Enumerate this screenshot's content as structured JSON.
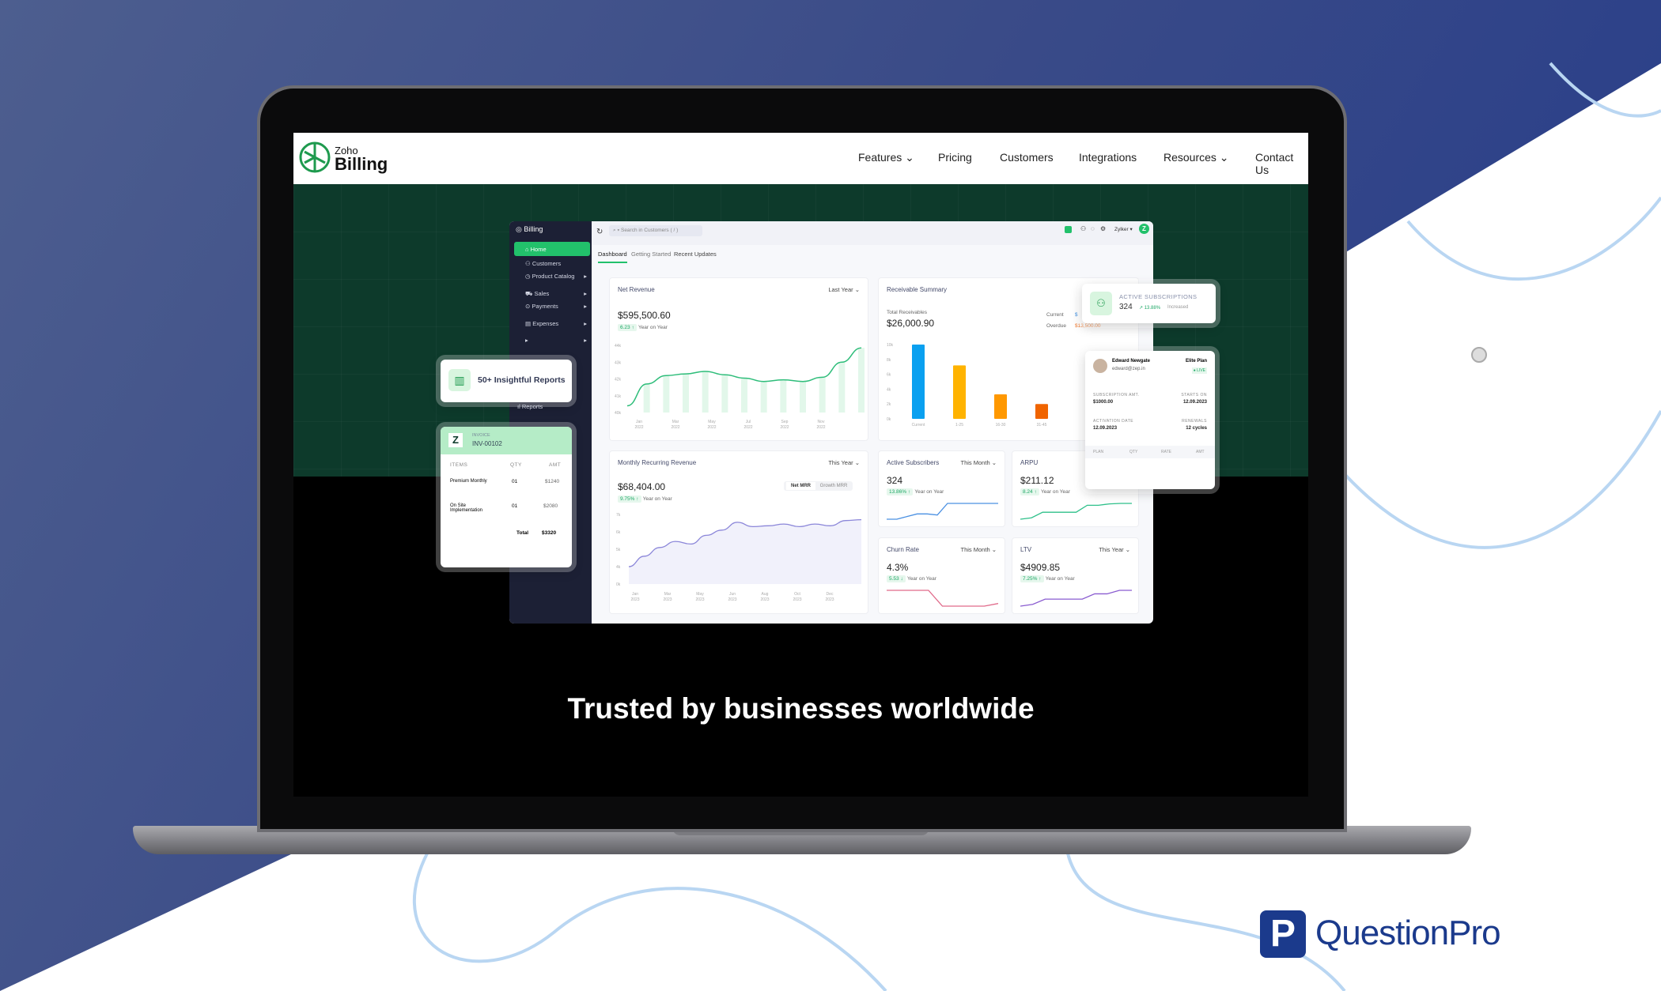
{
  "site": {
    "brand_small": "Zoho",
    "brand_large": "Billing",
    "nav": [
      "Features",
      "Pricing",
      "Customers",
      "Integrations",
      "Resources",
      "Contact Us"
    ],
    "headline": "Trusted by businesses worldwide"
  },
  "colors": {
    "accent": "#22c16b",
    "sidebar": "#1c2035",
    "hero": "#0d3a2b"
  },
  "dashboard": {
    "app_name": "Billing",
    "search_placeholder": "Search in Customers ( / )",
    "org": "Zylker",
    "avatar_letter": "Z",
    "sidebar": [
      "Home",
      "Customers",
      "Product Catalog",
      "Sales",
      "Payments",
      "Expenses",
      "",
      "Reports"
    ],
    "tabs": [
      "Dashboard",
      "Getting Started",
      "Recent Updates"
    ],
    "net_revenue": {
      "title": "Net Revenue",
      "period": "Last Year",
      "value": "$595,500.60",
      "change": "6.23 ↑",
      "change_label": "Year on Year",
      "yticks": [
        "44k",
        "43k",
        "42k",
        "41k",
        "40k"
      ],
      "xticks": [
        "Jan\n2022",
        "Mar\n2022",
        "May\n2022",
        "Jul\n2022",
        "Sep\n2022",
        "Nov\n2022"
      ],
      "yrange": [
        40,
        44
      ],
      "values": [
        40.4,
        41.7,
        42.2,
        42.3,
        42.45,
        42.25,
        42.05,
        41.85,
        41.95,
        41.85,
        42.1,
        43.0,
        43.85
      ]
    },
    "receivables": {
      "title": "Receivable Summary",
      "total_label": "Total Receivables",
      "total": "$26,000.90",
      "current_label": "Current",
      "current_value": "$",
      "overdue_label": "Overdue",
      "overdue_value": "$13,500.00",
      "yticks": [
        "10k",
        "8k",
        "6k",
        "4k",
        "2k",
        "0k"
      ],
      "yrange": [
        0,
        10
      ],
      "categories": [
        "Current",
        "1-25",
        "16-30",
        "31-45"
      ],
      "values": [
        10,
        7.2,
        3.3,
        2
      ],
      "bar_colors": [
        "#0aa0f0",
        "#ffb300",
        "#ff9800",
        "#f06400"
      ]
    },
    "mrr": {
      "title": "Monthly Recurring Revenue",
      "period": "This Year",
      "value": "$68,404.00",
      "change": "9.75% ↑",
      "change_label": "Year on Year",
      "toggle": [
        "Net MRR",
        "Growth MRR"
      ],
      "yticks": [
        "7k",
        "6k",
        "5k",
        "4k",
        "0k"
      ],
      "xticks": [
        "Jan\n2023",
        "Mar\n2023",
        "May\n2023",
        "Jun\n2023",
        "Aug\n2023",
        "Oct\n2023",
        "Dec\n2023"
      ],
      "values": [
        4.0,
        4.6,
        5.1,
        5.45,
        5.3,
        5.8,
        6.1,
        6.55,
        6.3,
        6.35,
        6.45,
        6.3,
        6.45,
        6.35,
        6.65,
        6.7
      ]
    },
    "active_subscribers": {
      "title": "Active Subscribers",
      "period": "This Month",
      "value": "324",
      "change": "13.86% ↑",
      "change_label": "Year on Year",
      "color": "#4a90e2",
      "values": [
        0,
        0,
        1,
        2,
        2,
        1.6,
        6,
        6,
        6,
        6,
        6,
        6
      ]
    },
    "arpu": {
      "title": "ARPU",
      "value": "$211.12",
      "change": "8.24 ↑",
      "change_label": "Year on Year",
      "color": "#2ec08a",
      "values": [
        0,
        0.3,
        1.5,
        1.5,
        1.5,
        1.5,
        3,
        3,
        3.3,
        3.4,
        3.4
      ]
    },
    "churn": {
      "title": "Churn Rate",
      "period": "This Month",
      "value": "4.3%",
      "change": "5.53 ↓",
      "change_label": "Year on Year",
      "color": "#e06a8a",
      "values": [
        6,
        6,
        6,
        6,
        0,
        0,
        0,
        0,
        1
      ]
    },
    "ltv": {
      "title": "LTV",
      "period": "This Year",
      "value": "$4909.85",
      "change": "7.25% ↑",
      "change_label": "Year on Year",
      "color": "#8a5cd0",
      "values": [
        0,
        0.5,
        2,
        2,
        2,
        2,
        3.5,
        3.5,
        4.5,
        4.5
      ]
    }
  },
  "reports_card": {
    "label": "50+ Insightful Reports"
  },
  "invoice": {
    "label": "INVOICE",
    "number": "INV-00102",
    "headers": [
      "ITEMS",
      "QTY",
      "AMT"
    ],
    "rows": [
      [
        "Premium Monthly",
        "01",
        "$1240"
      ],
      [
        "On Site Implementation",
        "01",
        "$2080"
      ]
    ],
    "total_label": "Total",
    "total": "$3320"
  },
  "subscriptions_card": {
    "label": "ACTIVE SUBSCRIPTIONS",
    "value": "324",
    "change": "↗ 13.88%",
    "status": "Increased"
  },
  "customer_card": {
    "name": "Edward Newgate",
    "email": "edward@zep.in",
    "plan": "Elite Plan",
    "status": "● LIVE",
    "fields": [
      [
        "SUBSCRIPTION AMT.",
        "$1000.00"
      ],
      [
        "STARTS ON",
        "12.09.2023"
      ],
      [
        "ACTIVATION DATE",
        "12.09.2023"
      ],
      [
        "RENEWALS",
        "12 cycles"
      ]
    ],
    "table_headers": [
      "PLAN",
      "QTY",
      "RATE",
      "AMT"
    ]
  },
  "watermark": {
    "brand": "QuestionPro"
  }
}
